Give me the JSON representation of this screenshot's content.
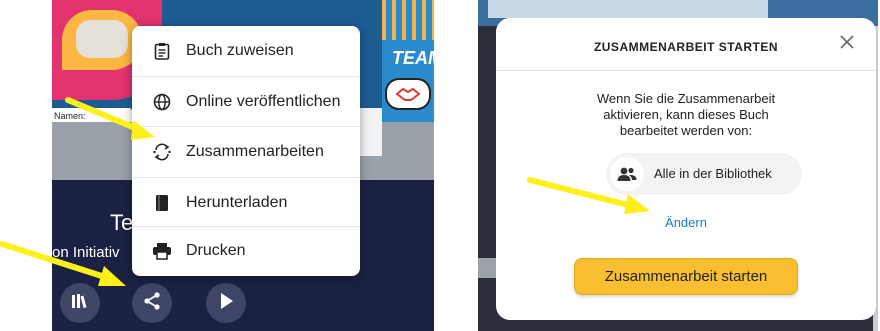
{
  "left": {
    "cover_team_text": "TEAM",
    "name_label": "Namen:",
    "book_title": "Te",
    "book_subtitle": "on Initiativ",
    "menu": {
      "items": [
        {
          "label": "Buch zuweisen",
          "icon": "clipboard-icon"
        },
        {
          "label": "Online veröffentlichen",
          "icon": "globe-icon"
        },
        {
          "label": "Zusammenarbeiten",
          "icon": "collaborate-arrows-icon"
        },
        {
          "label": "Herunterladen",
          "icon": "book-download-icon"
        },
        {
          "label": "Drucken",
          "icon": "printer-icon"
        }
      ]
    },
    "toolbar": {
      "buttons": [
        {
          "icon": "library-icon"
        },
        {
          "icon": "share-icon"
        },
        {
          "icon": "play-icon"
        }
      ]
    }
  },
  "right": {
    "dialog": {
      "title": "ZUSAMMENARBEIT STARTEN",
      "description": "Wenn Sie die Zusammenarbeit aktivieren, kann dieses Buch bearbeitet werden von:",
      "audience_label": "Alle in der Bibliothek",
      "change_link": "Ändern",
      "start_button": "Zusammenarbeit starten"
    }
  },
  "colors": {
    "arrow": "#ffef1a",
    "accent_button": "#f8c030",
    "link": "#1a7fc7",
    "dark_bg": "#1a2142"
  }
}
